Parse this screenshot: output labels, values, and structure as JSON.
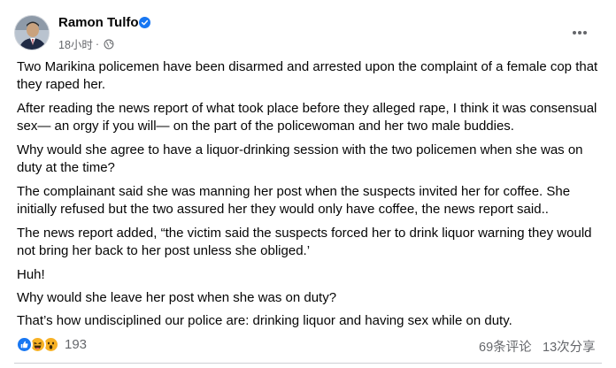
{
  "post": {
    "author": "Ramon Tulfo",
    "timestamp": "18小时",
    "privacy_icon": "globe-icon",
    "verified_icon": "verified-badge-icon",
    "menu_icon": "more-options-icon",
    "paragraphs": [
      "Two Marikina policemen have been disarmed and arrested upon the complaint of a female cop that they raped her.",
      "After reading the news report of what took place before they alleged rape, I think it was consensual sex— an orgy if you will— on the part of the policewoman and her two male buddies.",
      "Why would she agree to have a liquor-drinking session with the two policemen when she was on duty at the time?",
      "The complainant said she was manning her post when the suspects invited her for coffee. She initially refused but the two assured her they would only have coffee, the news report said..",
      "The news report added, “the victim said the suspects forced her to drink liquor warning they would not bring her back to her post unless she obliged.’",
      "Huh!",
      "Why would she leave her post when she was on duty?",
      "That’s how undisciplined our police are: drinking liquor and having sex while on duty."
    ],
    "reactions": {
      "icons": [
        "like-icon",
        "haha-icon",
        "wow-icon"
      ],
      "count": "193"
    },
    "comments": "69条评论",
    "shares": "13次分享"
  },
  "colors": {
    "verified": "#1877f2",
    "like": "#1877f2",
    "haha": "#f7b125",
    "secondary_text": "#65676b"
  }
}
